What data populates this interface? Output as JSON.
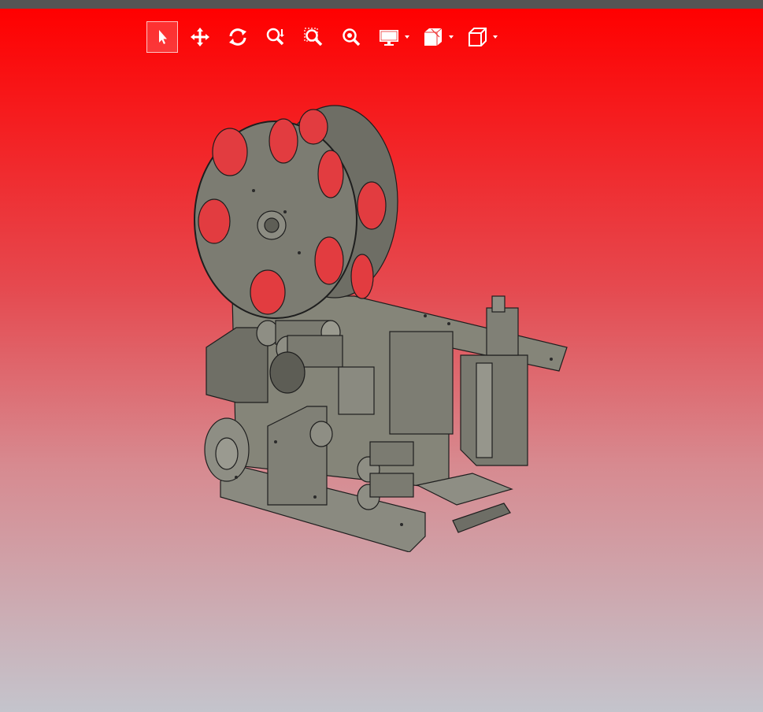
{
  "colors": {
    "topbar": "#555555",
    "gradient_top": "#ff0000",
    "gradient_bottom": "#c4c4cc",
    "icon": "#ffffff",
    "model_fill": "#7a7a70",
    "model_stroke": "#1e1e1e"
  },
  "toolbar": {
    "tools": [
      {
        "icon": "select-arrow-icon",
        "active": true
      },
      {
        "icon": "pan-move-icon",
        "active": false
      },
      {
        "icon": "rotate-icon",
        "active": false
      },
      {
        "icon": "zoom-area-icon",
        "active": false
      },
      {
        "icon": "zoom-box-icon",
        "active": false
      },
      {
        "icon": "zoom-fit-icon",
        "active": false
      },
      {
        "icon": "display-monitor-icon",
        "dropdown": true
      },
      {
        "icon": "section-view-icon",
        "dropdown": true
      },
      {
        "icon": "view-cube-icon",
        "dropdown": true
      }
    ]
  },
  "model": {
    "description_icon": "cad-labeling-machine-model"
  }
}
